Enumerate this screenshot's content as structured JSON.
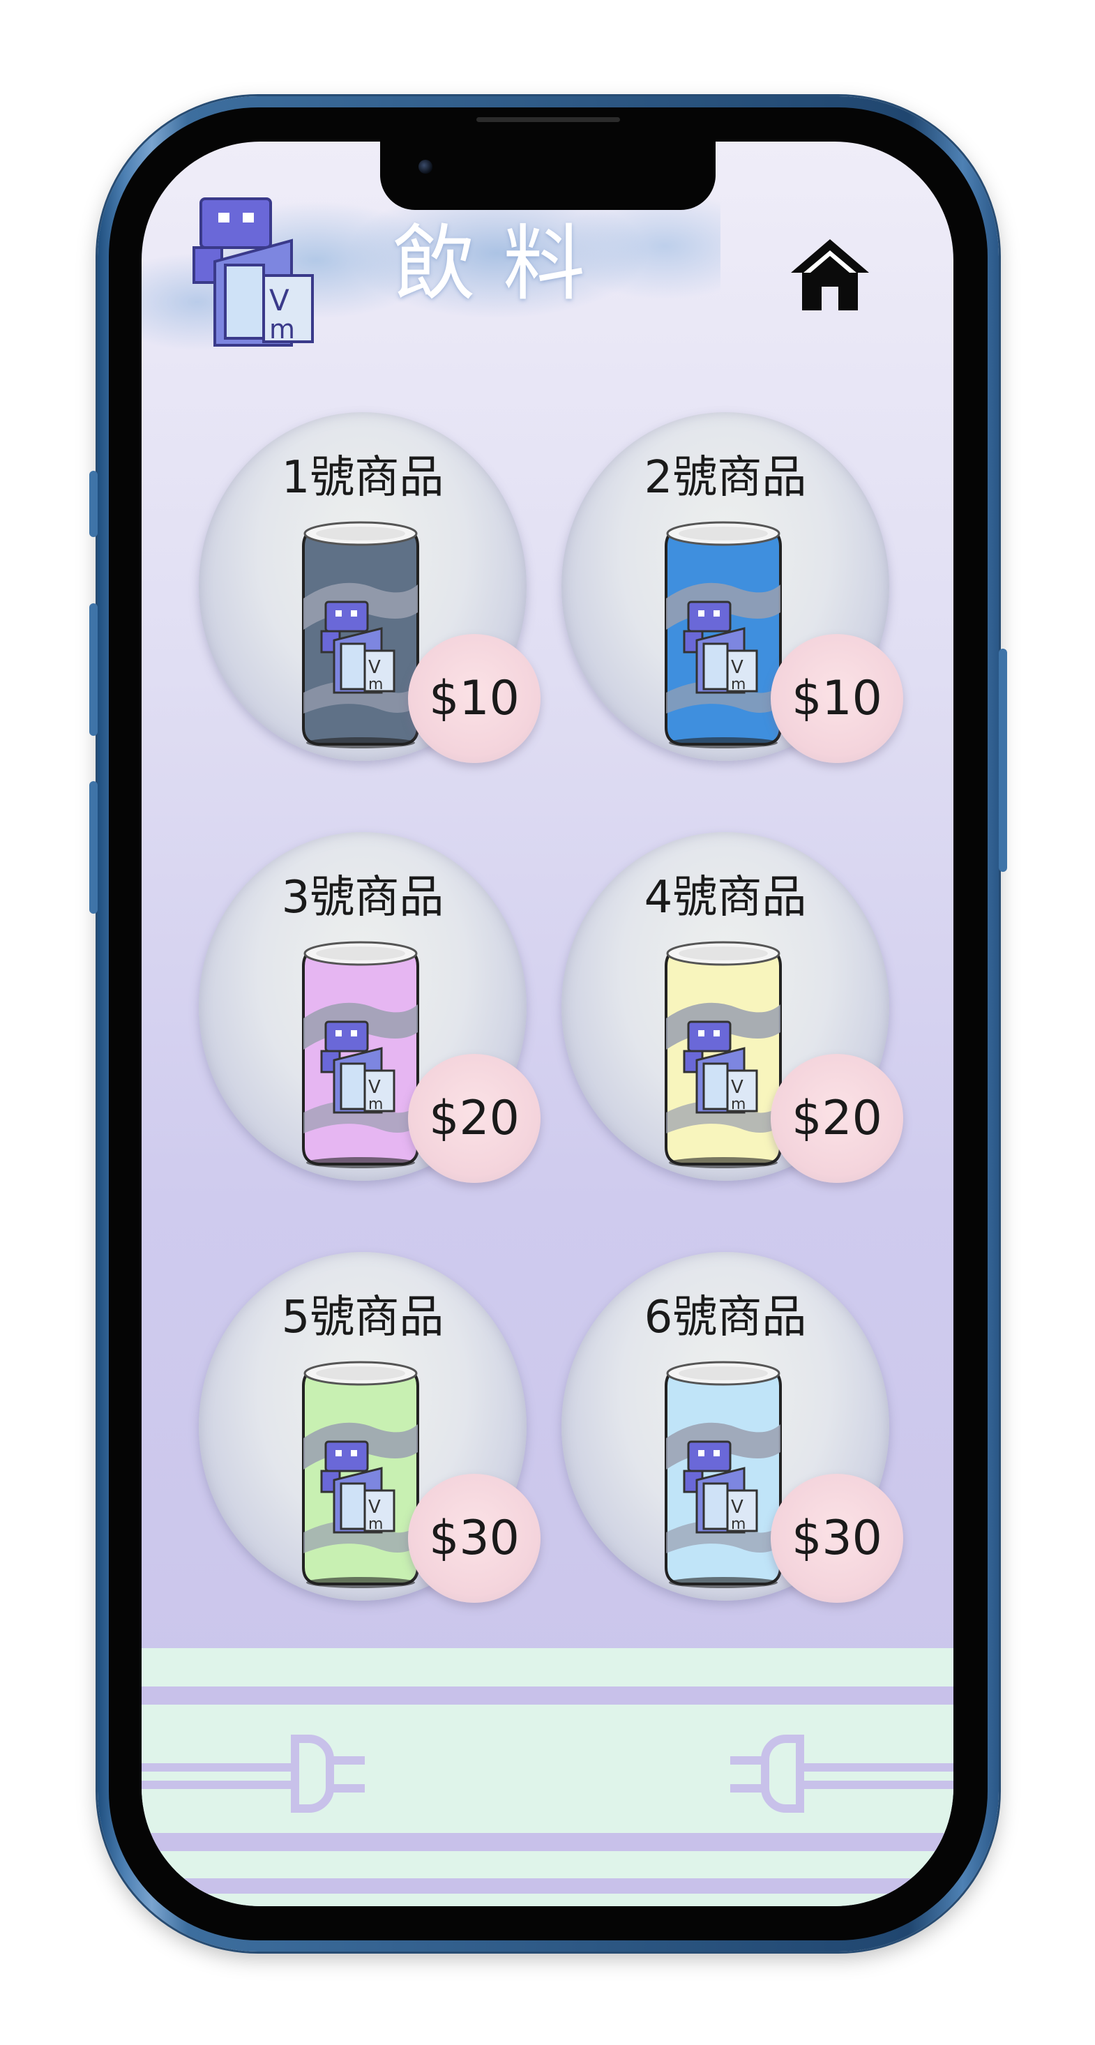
{
  "header": {
    "title": "飲料",
    "logo_icon": "vm-robot-logo",
    "home_icon": "home-icon"
  },
  "products": [
    {
      "label": "1號商品",
      "price": "$10",
      "can_color": "#5f7187"
    },
    {
      "label": "2號商品",
      "price": "$10",
      "can_color": "#3f8fde"
    },
    {
      "label": "3號商品",
      "price": "$20",
      "can_color": "#e6b6f2"
    },
    {
      "label": "4號商品",
      "price": "$20",
      "can_color": "#f8f5bd"
    },
    {
      "label": "5號商品",
      "price": "$30",
      "can_color": "#c8f0b2"
    },
    {
      "label": "6號商品",
      "price": "$30",
      "can_color": "#c0e4f8"
    }
  ],
  "colors": {
    "screen_top": "#efedf8",
    "screen_bottom": "#c9c4ea",
    "footer_bg": "#dff4ea",
    "footer_stripe": "#c8c1ea",
    "logo_purple": "#6f6fd6"
  }
}
